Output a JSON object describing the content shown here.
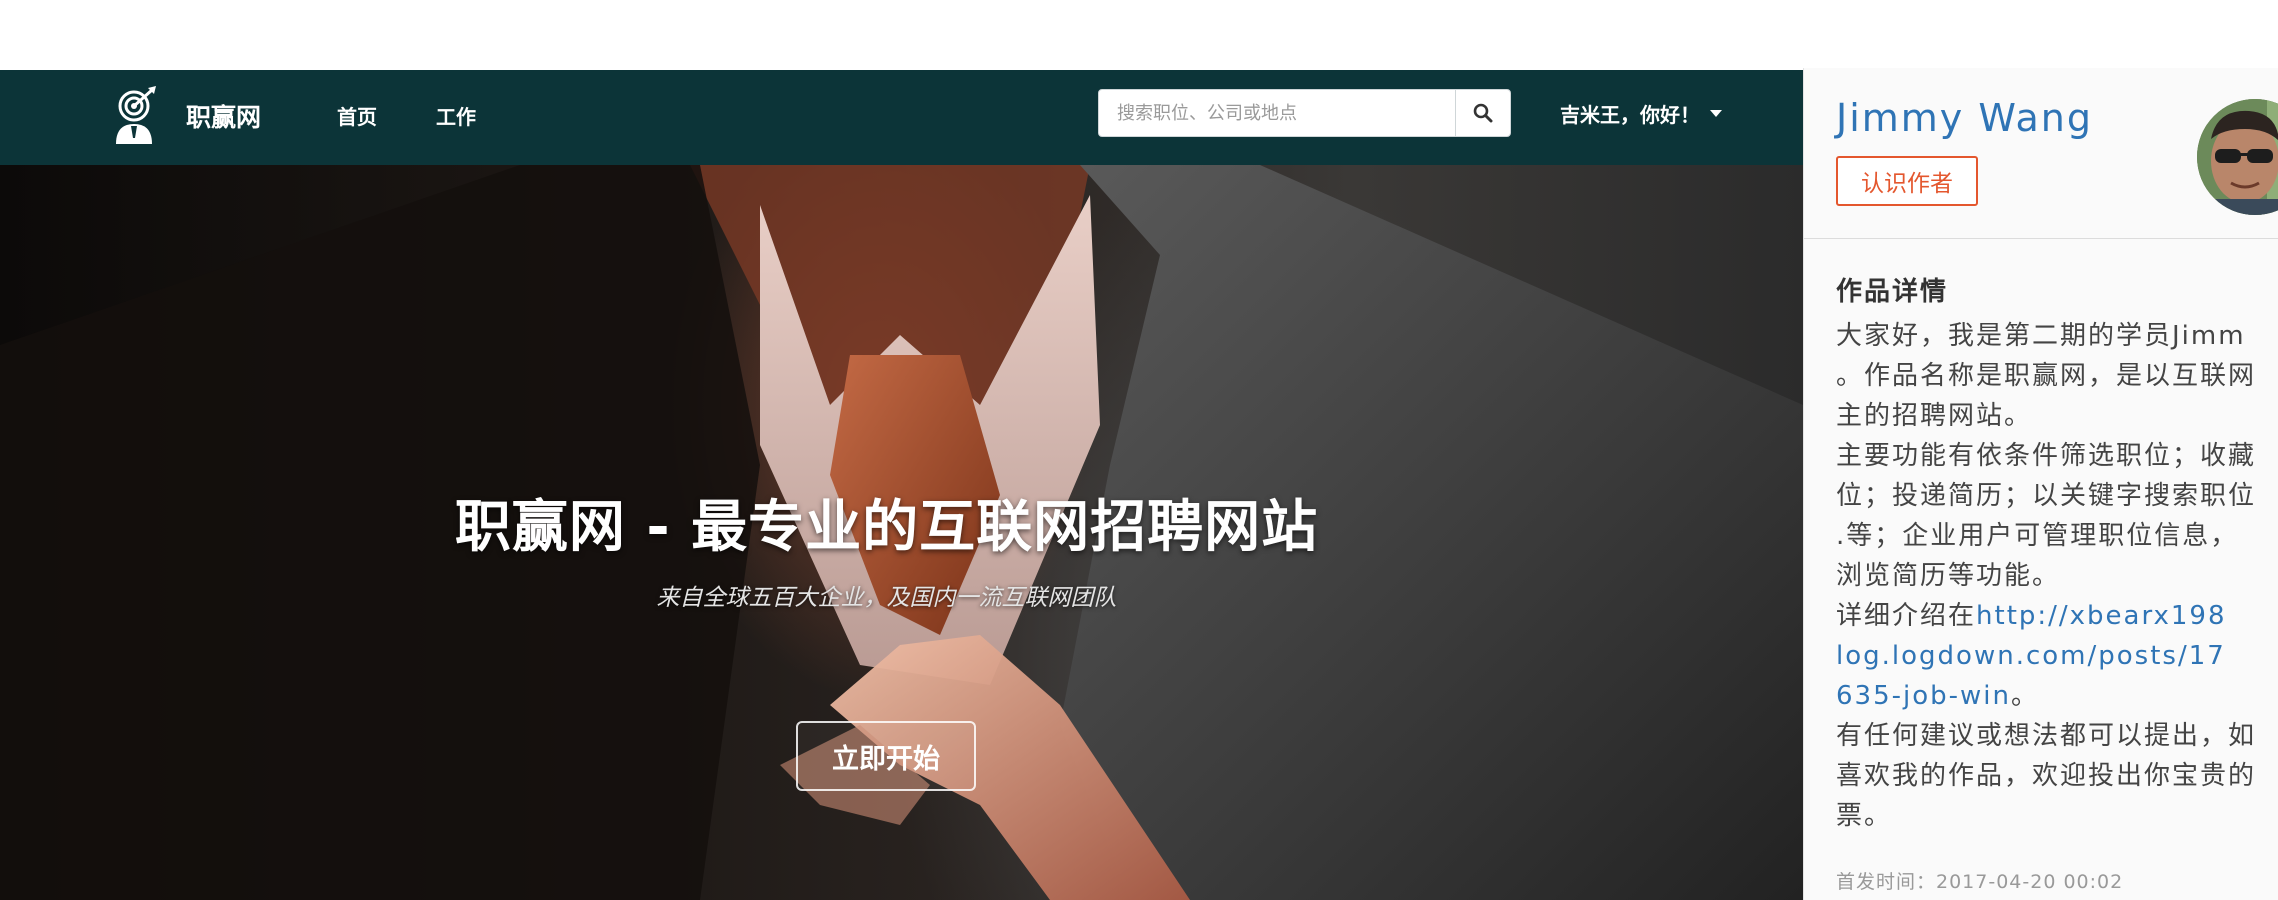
{
  "site": {
    "brand": "职赢网",
    "nav": {
      "home": "首页",
      "jobs": "工作"
    },
    "search": {
      "placeholder": "搜索职位、公司或地点"
    },
    "user_greeting": "吉米王，你好！"
  },
  "hero": {
    "title": "职赢网 - 最专业的互联网招聘网站",
    "subtitle": "来自全球五百大企业，及国内一流互联网团队",
    "cta": "立即开始"
  },
  "sidebar": {
    "author_name": "Jimmy Wang",
    "author_button": "认识作者",
    "detail_title": "作品详情",
    "detail_lines": [
      "大家好，我是第二期的学员Jimm",
      "。作品名称是职赢网，是以互联网",
      "主的招聘网站。",
      "主要功能有依条件筛选职位；收藏",
      "位；投递简历；以关键字搜索职位",
      ".等；企业用户可管理职位信息，",
      "浏览简历等功能。"
    ],
    "link_prefix": "详细介绍在",
    "link_lines": [
      "http://xbearx198",
      "log.logdown.com/posts/17",
      "635-job-win"
    ],
    "link_suffix": "。",
    "closing_lines": [
      "有任何建议或想法都可以提出，如",
      "喜欢我的作品，欢迎投出你宝贵的",
      "票。"
    ],
    "publish_time": "首发时间：2017-04-20 00:02"
  },
  "colors": {
    "nav_bg": "#0c3438",
    "link": "#2f74b5",
    "accent": "#e4572e"
  },
  "icons": [
    "target-person-logo-icon",
    "search-icon",
    "caret-down-icon",
    "author-avatar"
  ]
}
